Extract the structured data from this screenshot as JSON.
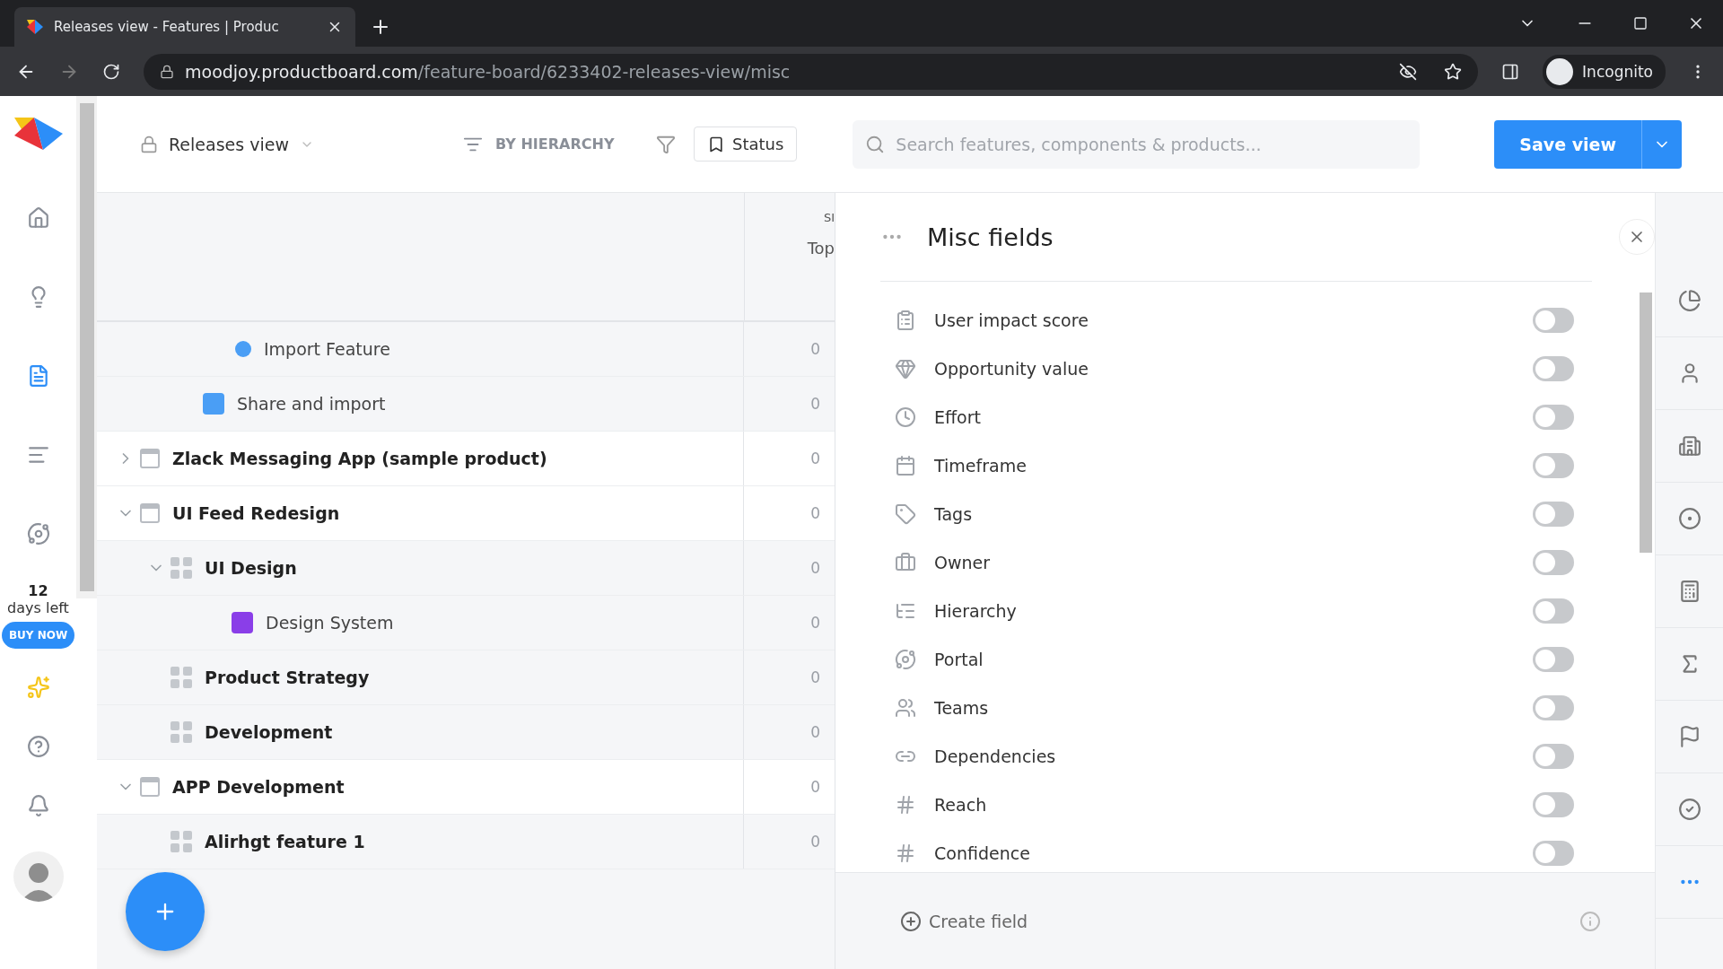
{
  "browser": {
    "tab_title": "Releases view - Features | Produc",
    "url_host": "moodjoy.productboard.com",
    "url_path": "/feature-board/6233402-releases-view/misc",
    "profile": "Incognito"
  },
  "header": {
    "view_name": "Releases view",
    "grouping": "BY HIERARCHY",
    "status_button": "Status",
    "search": {
      "placeholder": "Search features, components & products..."
    },
    "save_button": "Save view"
  },
  "nav": {
    "trial_days": "12",
    "trial_label": "days left",
    "buy_button": "BUY NOW"
  },
  "board": {
    "column_headers": [
      "SI",
      "Top"
    ],
    "rows": [
      {
        "kind": "feature",
        "label": "Import Feature",
        "color": "#4a9ef5",
        "value": "0"
      },
      {
        "kind": "subfeature",
        "label": "Share and import",
        "color": "#4a9ef5",
        "value": "0"
      },
      {
        "kind": "product",
        "label": "Zlack Messaging App (sample product)",
        "expanded": false,
        "value": "0"
      },
      {
        "kind": "product",
        "label": "UI Feed Redesign",
        "expanded": true,
        "value": "0"
      },
      {
        "kind": "component",
        "label": "UI Design",
        "expanded": true,
        "value": "0"
      },
      {
        "kind": "subfeature2",
        "label": "Design System",
        "color": "#8a3ee8",
        "value": "0"
      },
      {
        "kind": "component",
        "label": "Product Strategy",
        "value": "0"
      },
      {
        "kind": "component",
        "label": "Development",
        "value": "0"
      },
      {
        "kind": "product",
        "label": "APP Development",
        "expanded": true,
        "value": "0"
      },
      {
        "kind": "component",
        "label": "Alirhgt feature 1",
        "value": "0"
      }
    ]
  },
  "panel": {
    "title": "Misc fields",
    "fields": [
      {
        "label": "User impact score",
        "on": false
      },
      {
        "label": "Opportunity value",
        "on": false
      },
      {
        "label": "Effort",
        "on": false
      },
      {
        "label": "Timeframe",
        "on": false
      },
      {
        "label": "Tags",
        "on": false
      },
      {
        "label": "Owner",
        "on": false
      },
      {
        "label": "Hierarchy",
        "on": false
      },
      {
        "label": "Portal",
        "on": false
      },
      {
        "label": "Teams",
        "on": false
      },
      {
        "label": "Dependencies",
        "on": false
      },
      {
        "label": "Reach",
        "on": false
      },
      {
        "label": "Confidence",
        "on": false
      }
    ],
    "create_button": "Create field"
  }
}
